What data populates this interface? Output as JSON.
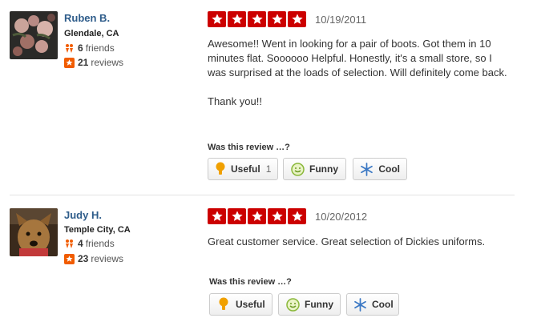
{
  "reviews": [
    {
      "user": {
        "name": "Ruben B.",
        "location": "Glendale, CA",
        "friends": "6",
        "friends_label": "friends",
        "reviews": "21",
        "reviews_label": "reviews"
      },
      "rating": 5,
      "date": "10/19/2011",
      "body": [
        "Awesome!!  Went in looking for a pair of boots.  Got them in 10 minutes flat. Soooooo Helpful.  Honestly, it's a small store, so I was surprised at the loads of selection.  Will definitely come back.",
        "Thank you!!"
      ],
      "prompt": "Was this review …?",
      "votes": {
        "useful": "Useful",
        "useful_count": "1",
        "funny": "Funny",
        "cool": "Cool"
      }
    },
    {
      "user": {
        "name": "Judy H.",
        "location": "Temple City, CA",
        "friends": "4",
        "friends_label": "friends",
        "reviews": "23",
        "reviews_label": "reviews"
      },
      "rating": 5,
      "date": "10/20/2012",
      "body": [
        "Great customer service. Great selection of Dickies uniforms."
      ],
      "prompt": "Was this review …?",
      "votes": {
        "useful": "Useful",
        "funny": "Funny",
        "cool": "Cool"
      }
    }
  ],
  "icons": {
    "star": "star-icon",
    "friends": "friends-icon",
    "reviews": "review-count-icon",
    "useful": "lightbulb-icon",
    "funny": "smiley-icon",
    "cool": "snowflake-icon"
  },
  "colors": {
    "star_bg": "#cc0000",
    "name_link": "#2e5c8a",
    "friends_icon": "#f15c00",
    "reviews_icon": "#f15c00"
  }
}
